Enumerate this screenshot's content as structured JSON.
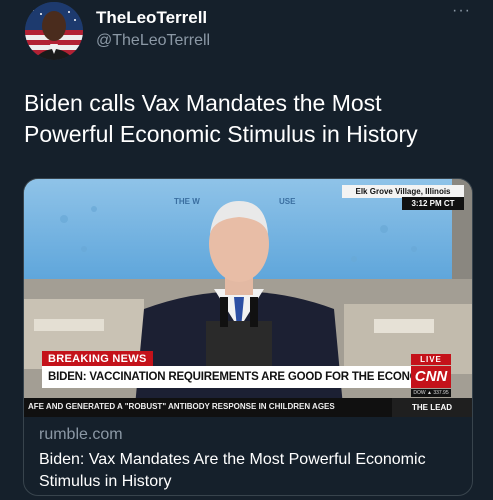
{
  "tweet": {
    "display_name": "TheLeoTerrell",
    "handle": "@TheLeoTerrell",
    "more_icon": "···",
    "text": "Biden calls Vax Mandates the Most Powerful Economic Stimulus in History"
  },
  "card": {
    "domain": "rumble.com",
    "title": "Biden: Vax Mandates Are the Most Powerful Economic Stimulus in History",
    "broadcast": {
      "location": "Elk Grove Village, Illinois",
      "time": "3:12 PM CT",
      "tag": "BREAKING NEWS",
      "headline": "BIDEN: VACCINATION REQUIREMENTS ARE GOOD FOR THE ECONOMY",
      "live": "LIVE",
      "network": "CNN",
      "dow": "DOW ▲ 337.95",
      "ticker": "AFE AND GENERATED A \"ROBUST\" ANTIBODY RESPONSE IN CHILDREN AGES",
      "show": "THE LEAD"
    }
  },
  "colors": {
    "background": "#15202b",
    "secondary_text": "#8b98a5",
    "border": "#38444d",
    "breaking_red": "#c4121a"
  }
}
